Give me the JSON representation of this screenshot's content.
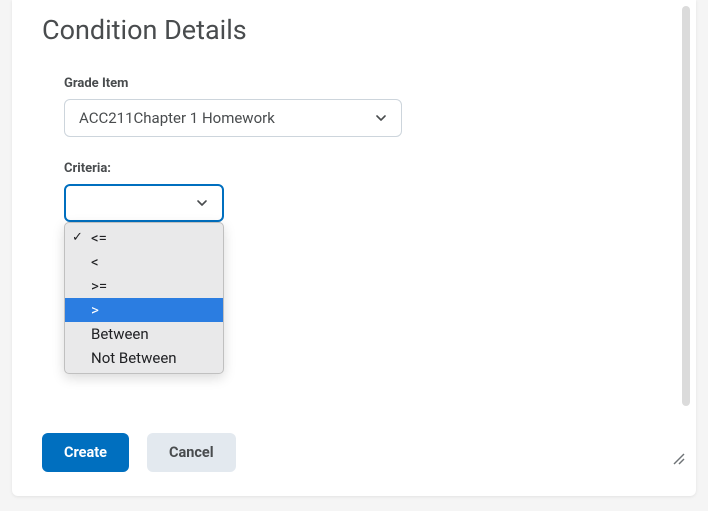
{
  "title": "Condition Details",
  "gradeItem": {
    "label": "Grade Item",
    "selected": "ACC211Chapter 1 Homework"
  },
  "criteria": {
    "label": "Criteria:",
    "options": [
      {
        "label": "<=",
        "selected": true,
        "highlighted": false
      },
      {
        "label": "<",
        "selected": false,
        "highlighted": false
      },
      {
        "label": ">=",
        "selected": false,
        "highlighted": false
      },
      {
        "label": ">",
        "selected": false,
        "highlighted": true
      },
      {
        "label": "Between",
        "selected": false,
        "highlighted": false
      },
      {
        "label": "Not Between",
        "selected": false,
        "highlighted": false
      }
    ]
  },
  "buttons": {
    "create": "Create",
    "cancel": "Cancel"
  }
}
